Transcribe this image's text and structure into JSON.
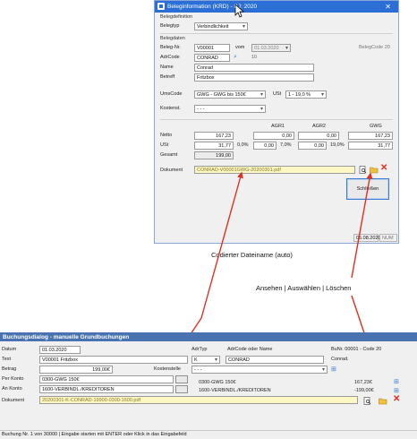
{
  "dialog1": {
    "title": "Beleginformation (KRD) - BJ: 2020",
    "close": "✕",
    "group_belegdefinition": "Belegdefinition",
    "belegtyp_label": "Belegtyp",
    "belegtyp_value": "Verbindlichkeit",
    "group_belegdaten": "Belegdaten",
    "belegnr_label": "Beleg-Nr.",
    "belegnr_value": "V00001",
    "vom_label": "vom",
    "vom_value": "01.03.2020",
    "belegcode": "BelegCode 20",
    "adrcode_label": "AdrCode",
    "adrcode_value": "CONRAD",
    "adrcode_num": "10",
    "name_label": "Name",
    "name_value": "Conrad",
    "betreff_label": "Betreff",
    "betreff_value": "Fritzbox",
    "umscode_label": "UmsCode",
    "umscode_value": "GWG  - GWG bis 150€",
    "ust_label": "USt",
    "ust_value": "1 - 19,0 %",
    "kostenst_label": "Kostenst.",
    "kostenst_value": "- - -",
    "col_agr1": "AGR1",
    "col_agr2": "AGR2",
    "col_gwg": "GWG",
    "netto_label": "Netto",
    "netto_value": "167,23",
    "netto_agr1": "0,00",
    "netto_agr2": "0,00",
    "netto_gwg": "167,23",
    "ust_row_label": "USt",
    "ust_row_value": "31,77",
    "ust_pct1": "0,0%",
    "ust_agr1": "0,00",
    "ust_pct2": "7,0%",
    "ust_agr2": "0,00",
    "ust_pct3": "19,0%",
    "ust_gwg": "31,77",
    "gesamt_label": "Gesamt",
    "gesamt_value": "199,00",
    "dokument_label": "Dokument",
    "dokument_value": "CONRAD-V00001GWG-20200301.pdf",
    "schliessen": "Schließen",
    "status_date": "05.08.2020",
    "status_num": "NUM"
  },
  "callouts": {
    "codierter": "Codierter Dateiname (auto)",
    "ansehen": "Ansehen | Auswählen | Löschen"
  },
  "dialog2": {
    "title": "Buchungsdialog - manuelle Grundbuchungen",
    "datum_label": "Datum",
    "datum_value": "01.03.2020",
    "text_label": "Text",
    "text_value": "V00001 Fritzbox",
    "betrag_label": "Betrag",
    "betrag_value": "199,00€",
    "kostenstelle_label": "Kostenstelle",
    "kostenstelle_value": "- - -",
    "perkonto_label": "Per Konto",
    "perkonto_value": "0300-GWG 150€",
    "ankonto_label": "An Konto",
    "ankonto_value": "1600-VERBINDL./KREDITOREN",
    "dokument_label": "Dokument",
    "dokument_value": "20200301-K-CONRAD-19900-0300-1600.pdf",
    "adrtyp_label": "AdrTyp",
    "adrcode_label": "AdrCode oder Name",
    "adrtyp_value": "K",
    "adrcode_value": "CONRAD",
    "buchnr": "BuNr. 00001 - Code 20",
    "conrad": "Conrad.",
    "per_info": "0300-GWG 150€",
    "an_info": "1600-VERBINDL./KREDITOREN",
    "per_amount": "167,23€",
    "an_amount": "-199,00€",
    "status": "Buchung Nr. 1 von 30000 | Eingabe starten mit ENTER oder Klick in das Eingabefeld"
  },
  "colors": {
    "titlebar": "#2b6fd6",
    "header2": "#4973b0",
    "arrow": "#e0301e",
    "document_field": "#fdf7c4"
  }
}
